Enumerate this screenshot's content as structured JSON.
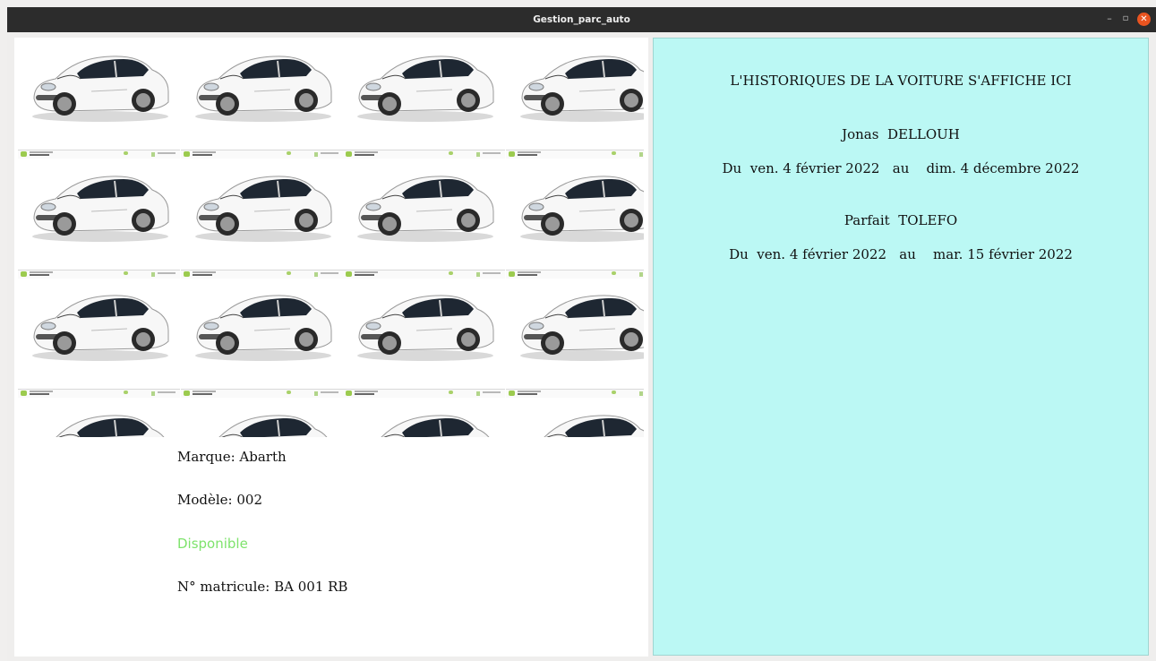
{
  "window": {
    "title": "Gestion_parc_auto",
    "minimize_glyph": "–",
    "maximize_glyph": "▫",
    "close_glyph": "✕"
  },
  "vehicle": {
    "image_icon": "car-photo-tiled",
    "marque": "Marque: Abarth",
    "modele": "Modèle: 002",
    "status": "Disponible",
    "status_color": "#7ee36c",
    "matricule": "N° matricule: BA 001 RB"
  },
  "history": {
    "heading": "L'HISTORIQUES DE LA VOITURE S'AFFICHE ICI",
    "panel_color": "#bbf8f4",
    "entries": [
      {
        "name": "Jonas  DELLOUH",
        "period": "Du  ven. 4 février 2022   au    dim. 4 décembre 2022"
      },
      {
        "name": "Parfait  TOLEFO",
        "period": "Du  ven. 4 février 2022   au    mar. 15 février 2022"
      }
    ]
  }
}
